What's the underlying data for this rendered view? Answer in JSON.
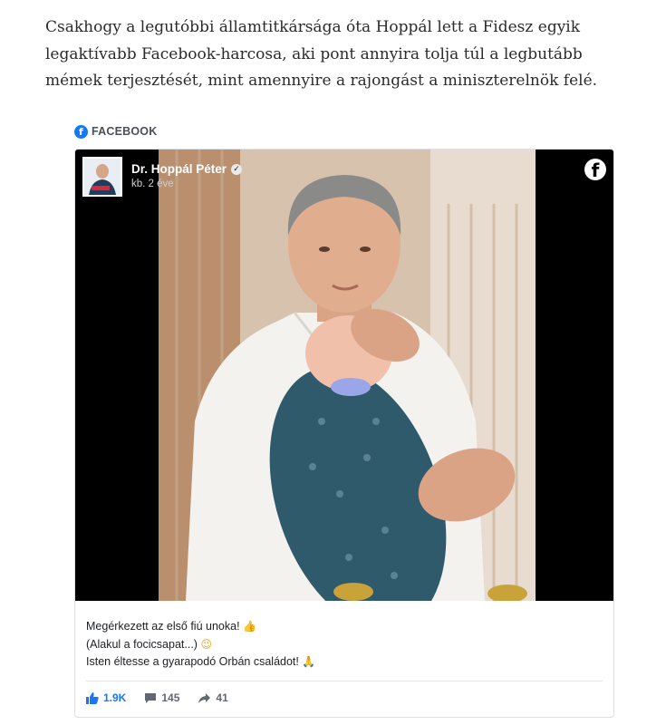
{
  "article": {
    "paragraph": "Csakhogy a legutóbbi államtitkársága óta Hoppál lett a Fidesz egyik legaktívabb Facebook-harcosa, aki pont annyira tolja túl a legbutább mémek terjesztését, mint amennyire a rajongást a miniszterelnök felé."
  },
  "embed": {
    "source_label": "FACEBOOK",
    "post": {
      "author": "Dr. Hoppál Péter",
      "time": "kb. 2 éve",
      "caption_lines": [
        "Megérkezett az első fiú unoka!",
        "(Alakul a focicsapat...)",
        "Isten éltesse a gyarapodó Orbán családot!"
      ],
      "emojis": [
        "👍",
        "😉",
        "🙏"
      ],
      "stats": {
        "likes": "1.9K",
        "comments": "145",
        "shares": "41"
      }
    }
  },
  "colors": {
    "facebook_blue": "#1877f2",
    "stat_blue": "#1877f2",
    "stat_gray": "#606770"
  }
}
